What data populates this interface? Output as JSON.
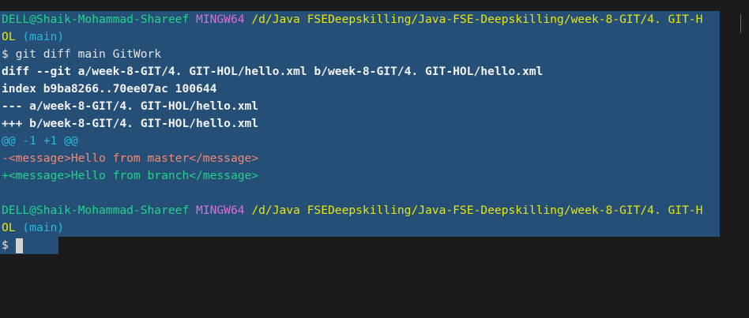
{
  "terminal": {
    "prompt1": {
      "user": "DELL@Shaik-Mohammad-Shareef",
      "shell": "MINGW64",
      "path": "/d/Java FSEDeepskilling/Java-FSE-Deepskilling/week-8-GIT/4. GIT-H",
      "path_cont": "OL",
      "branch": "(main)"
    },
    "command": "$ git diff main GitWork",
    "diff": {
      "header": "diff --git a/week-8-GIT/4. GIT-HOL/hello.xml b/week-8-GIT/4. GIT-HOL/hello.xml",
      "index": "index b9ba8266..70ee07ac 100644",
      "minus_file": "--- a/week-8-GIT/4. GIT-HOL/hello.xml",
      "plus_file": "+++ b/week-8-GIT/4. GIT-HOL/hello.xml",
      "hunk": "@@ -1 +1 @@",
      "removed": "-<message>Hello from master</message>",
      "added": "+<message>Hello from branch</message>"
    },
    "prompt2": {
      "user": "DELL@Shaik-Mohammad-Shareef",
      "shell": "MINGW64",
      "path": "/d/Java FSEDeepskilling/Java-FSE-Deepskilling/week-8-GIT/4. GIT-H",
      "path_cont": "OL",
      "branch": "(main)"
    },
    "dollar": "$"
  },
  "colors": {
    "background": "#1b1b1b",
    "selection": "#264f78",
    "green": "#23d18b",
    "magenta": "#d670d6",
    "yellow": "#e5e510",
    "cyan": "#29b8db",
    "removed": "#f48771"
  }
}
